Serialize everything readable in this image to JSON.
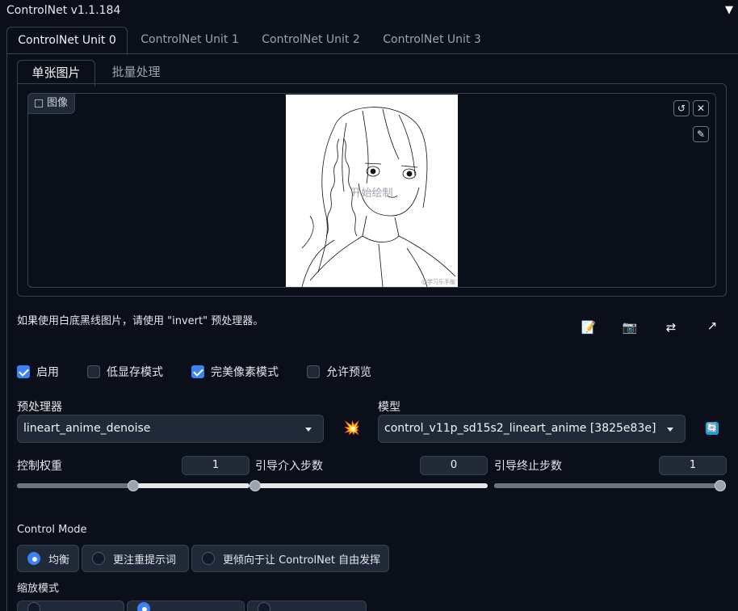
{
  "header": {
    "title": "ControlNet v1.1.184",
    "collapse_icon": "triangle-down-icon"
  },
  "unit_tabs": [
    "ControlNet Unit 0",
    "ControlNet Unit 1",
    "ControlNet Unit 2",
    "ControlNet Unit 3"
  ],
  "input_tabs": [
    "单张图片",
    "批量处理"
  ],
  "image_panel": {
    "label": "图像",
    "canvas_text": "开始绘制",
    "watermark": "@学习乐手版",
    "buttons": {
      "reset": "↺",
      "clear": "✕",
      "brush": "✎"
    }
  },
  "hint": "如果使用白底黑线图片，请使用 \"invert\" 预处理器。",
  "tools": {
    "edit": "📝",
    "camera": "📷",
    "swap": "⇄",
    "send": "↗"
  },
  "checkboxes": [
    {
      "label": "启用",
      "checked": true
    },
    {
      "label": "低显存模式",
      "checked": false
    },
    {
      "label": "完美像素模式",
      "checked": true
    },
    {
      "label": "允许预览",
      "checked": false
    }
  ],
  "preprocessor": {
    "label": "预处理器",
    "value": "lineart_anime_denoise",
    "run_icon": "💥"
  },
  "model": {
    "label": "模型",
    "value": "control_v11p_sd15s2_lineart_anime [3825e83e]",
    "refresh_icon": "🔄"
  },
  "sliders": [
    {
      "label": "控制权重",
      "value": "1",
      "fraction": 0.5
    },
    {
      "label": "引导介入步数",
      "value": "0",
      "fraction": 0.0
    },
    {
      "label": "引导终止步数",
      "value": "1",
      "fraction": 1.0
    }
  ],
  "control_mode": {
    "label": "Control Mode",
    "options": [
      {
        "label": "均衡",
        "selected": true
      },
      {
        "label": "更注重提示词",
        "selected": false
      },
      {
        "label": "更倾向于让 ControlNet 自由发挥",
        "selected": false
      }
    ]
  },
  "resize_mode": {
    "label": "缩放模式"
  }
}
